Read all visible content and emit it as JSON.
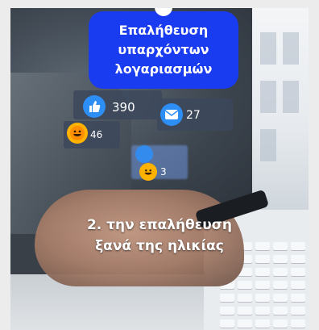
{
  "title_bubble": {
    "line1": "Επαλήθευση",
    "line2": "υπαρχόντων",
    "line3": "λογαριασμών"
  },
  "reactions": {
    "likes": "390",
    "messages": "27",
    "laughs": "46",
    "laughs_small": "3"
  },
  "caption": {
    "line1": "2. την επαλήθευση",
    "line2": "ξανά της ηλικίας"
  },
  "colors": {
    "bubble_blue": "#1a3cf0",
    "like_blue": "#2d8ef5",
    "emoji_yellow": "#ffb300"
  }
}
